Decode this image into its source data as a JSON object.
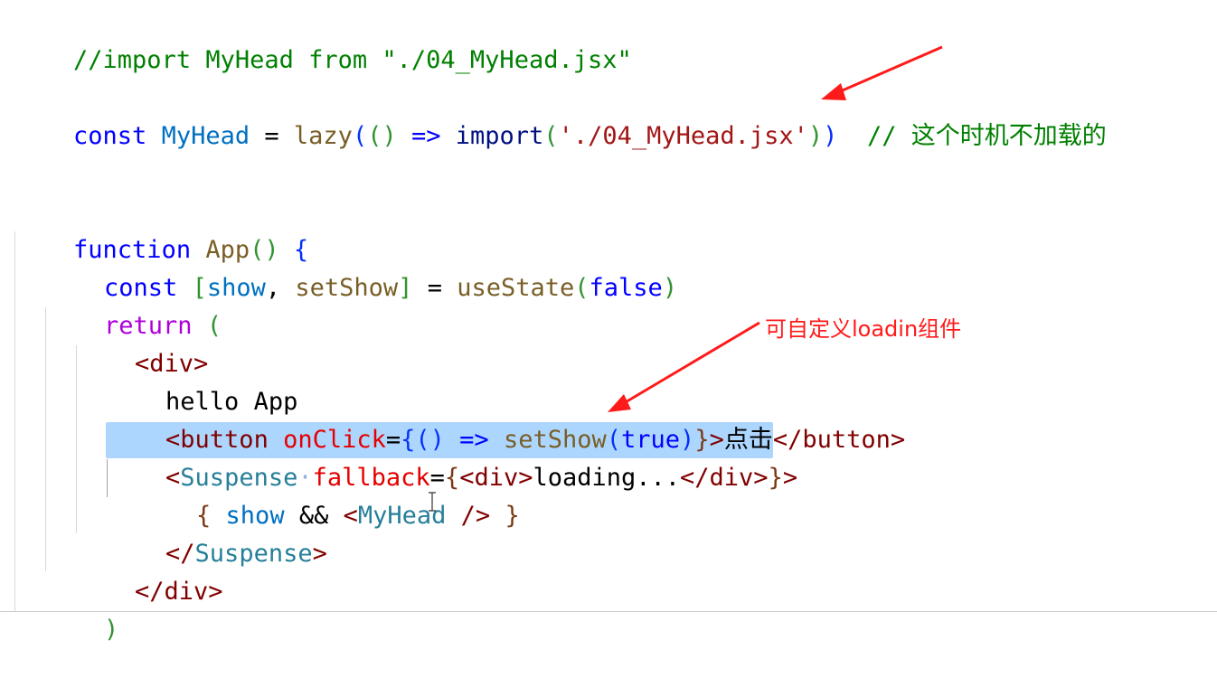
{
  "code": {
    "line1": {
      "comment": "//import MyHead from \"./04_MyHead.jsx\""
    },
    "line2": {
      "const_kw": "const",
      "name": "MyHead",
      "eq": " = ",
      "lazy": "lazy",
      "open1": "(",
      "open2": "()",
      "arrow": " => ",
      "import_kw": "import",
      "open3": "(",
      "path": "'./04_MyHead.jsx'",
      "close3": ")",
      "close1": ")",
      "comment": "// 这个时机不加载的"
    },
    "line3": {
      "function_kw": "function",
      "name": " App",
      "parens": "()",
      "brace": " {"
    },
    "line4": {
      "const_kw": "const",
      "open": " [",
      "show": "show",
      "comma": ", ",
      "setShow": "setShow",
      "close": "]",
      "eq": " = ",
      "useState": "useState",
      "open_p": "(",
      "false_kw": "false",
      "close_p": ")"
    },
    "line5": {
      "return_kw": "return",
      "paren": " ("
    },
    "line6": {
      "tag": "<div>"
    },
    "line7": {
      "text": "hello App"
    },
    "line8": {
      "tag_open": "<button",
      "attr": " onClick",
      "eq": "=",
      "brace_open": "{",
      "parens": "()",
      "arrow": " => ",
      "fn": "setShow",
      "p_open": "(",
      "true_kw": "true",
      "p_close": ")",
      "brace_close": "}",
      "gt": ">",
      "text": "点击",
      "tag_close": "</button>"
    },
    "line9": {
      "lt": "<",
      "component": "Suspense",
      "space": "·",
      "attr": "fallback",
      "eq": "=",
      "brace_open": "{",
      "div_open": "<div>",
      "text": "loading...",
      "div_close": "</div>",
      "brace_close": "}",
      "gt": ">"
    },
    "line10": {
      "brace_open": "{ ",
      "show": "show",
      "and": " && ",
      "lt": "<",
      "component": "MyHead",
      "self_close": " />",
      "brace_close": " }"
    },
    "line11": {
      "lt": "</",
      "component": "Suspense",
      "gt": ">"
    },
    "line12": {
      "tag": "</div>"
    },
    "line13": {
      "paren": ")"
    }
  },
  "annotations": {
    "custom_loading": "可自定义loadin组件"
  },
  "colors": {
    "annotation": "#ff1a1a",
    "selection": "#add6ff"
  }
}
